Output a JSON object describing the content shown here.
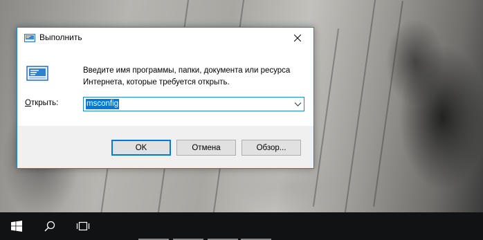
{
  "dialog": {
    "title": "Выполнить",
    "description": "Введите имя программы, папки, документа или ресурса Интернета, которые требуется открыть.",
    "open_label_accesskey": "О",
    "open_label_rest": "ткрыть:",
    "input_value": "msconfig",
    "buttons": {
      "ok": "OK",
      "cancel": "Отмена",
      "browse": "Обзор..."
    }
  },
  "taskbar": {
    "items": [
      "windows-start-icon",
      "search-icon",
      "task-view-icon"
    ]
  },
  "colors": {
    "accent": "#0078d7",
    "taskbar": "#111213",
    "dialog_bg": "#f0f0f0"
  }
}
